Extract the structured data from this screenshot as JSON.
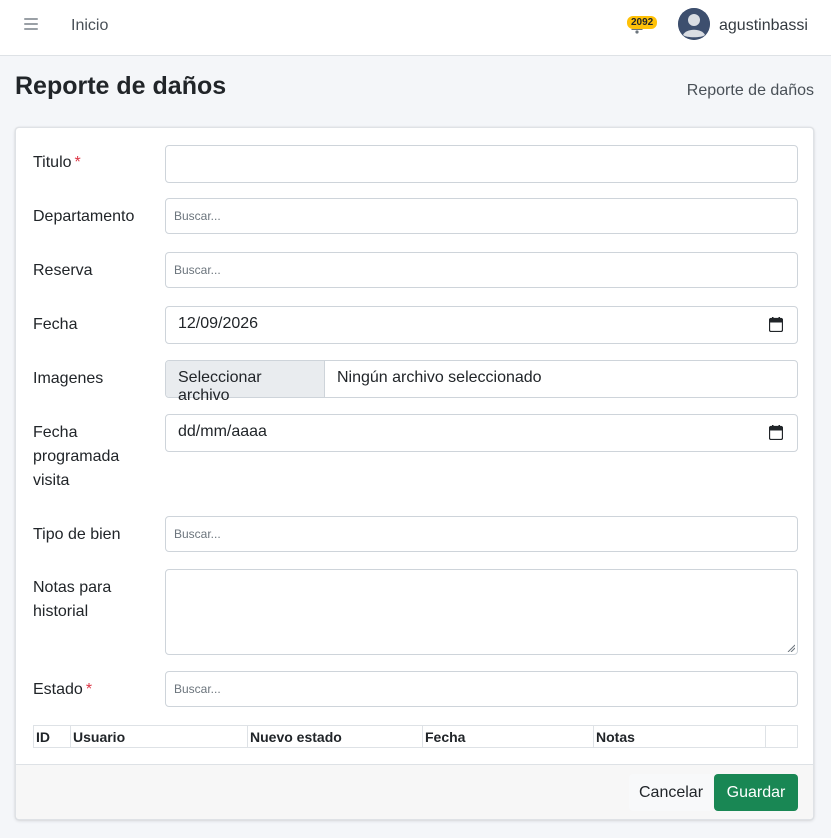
{
  "navbar": {
    "home_label": "Inicio",
    "notification_count": "2092",
    "username": "agustinbassi"
  },
  "header": {
    "title": "Reporte de daños",
    "breadcrumb": "Reporte de daños"
  },
  "form": {
    "titulo": {
      "label": "Titulo",
      "required_mark": "*",
      "value": ""
    },
    "departamento": {
      "label": "Departamento",
      "placeholder": "Buscar..."
    },
    "reserva": {
      "label": "Reserva",
      "placeholder": "Buscar..."
    },
    "fecha": {
      "label": "Fecha",
      "value": "12/09/2026"
    },
    "imagenes": {
      "label": "Imagenes",
      "button_label": "Seleccionar archivo",
      "status_text": "Ningún archivo seleccionado"
    },
    "fecha_visita": {
      "label_line1": "Fecha",
      "label_line2": "programada",
      "label_line3": "visita",
      "value": "dd/mm/aaaa"
    },
    "tipo_bien": {
      "label": "Tipo de bien",
      "placeholder": "Buscar..."
    },
    "notas": {
      "label_line1": "Notas para",
      "label_line2": "historial",
      "value": ""
    },
    "estado": {
      "label": "Estado",
      "required_mark": "*",
      "placeholder": "Buscar..."
    }
  },
  "history_table": {
    "columns": [
      "ID",
      "Usuario",
      "Nuevo estado",
      "Fecha",
      "Notas"
    ]
  },
  "footer": {
    "cancel_label": "Cancelar",
    "save_label": "Guardar"
  },
  "colors": {
    "save_button": "#198754",
    "badge": "#ffc107",
    "required": "#dc3545",
    "avatar": "#3d4f6e"
  }
}
